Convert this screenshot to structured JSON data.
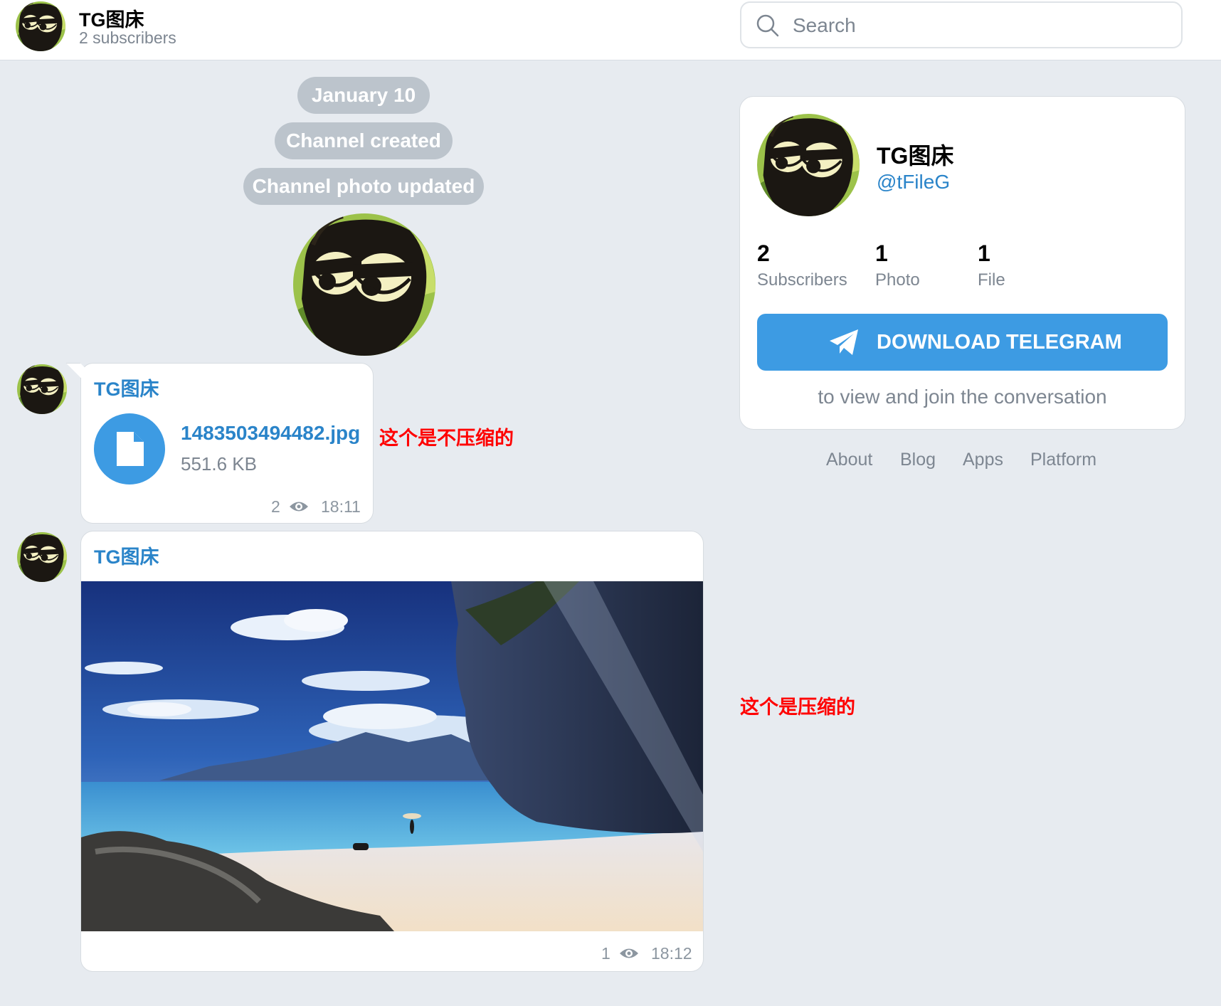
{
  "header": {
    "title": "TG图床",
    "subtitle": "2 subscribers",
    "search_placeholder": "Search"
  },
  "service_messages": [
    {
      "text": "January 10"
    },
    {
      "text": "Channel created"
    },
    {
      "text": "Channel photo updated"
    }
  ],
  "messages": [
    {
      "author": "TG图床",
      "document": {
        "name": "1483503494482.jpg",
        "size": "551.6 KB"
      },
      "views": "2",
      "time": "18:11"
    },
    {
      "author": "TG图床",
      "photo": "beach-scene",
      "views": "1",
      "time": "18:12"
    }
  ],
  "annotations": {
    "uncompressed": "这个是不压缩的",
    "compressed": "这个是压缩的"
  },
  "channel_card": {
    "title": "TG图床",
    "handle": "@tFileG",
    "stats": [
      {
        "value": "2",
        "label": "Subscribers"
      },
      {
        "value": "1",
        "label": "Photo"
      },
      {
        "value": "1",
        "label": "File"
      }
    ],
    "download_label": "DOWNLOAD TELEGRAM",
    "note": "to view and join the conversation"
  },
  "footer_links": [
    "About",
    "Blog",
    "Apps",
    "Platform"
  ],
  "colors": {
    "accent": "#3d9be3",
    "link": "#2a84c9",
    "background": "#e7ebf0",
    "annotation": "#ff0000"
  }
}
